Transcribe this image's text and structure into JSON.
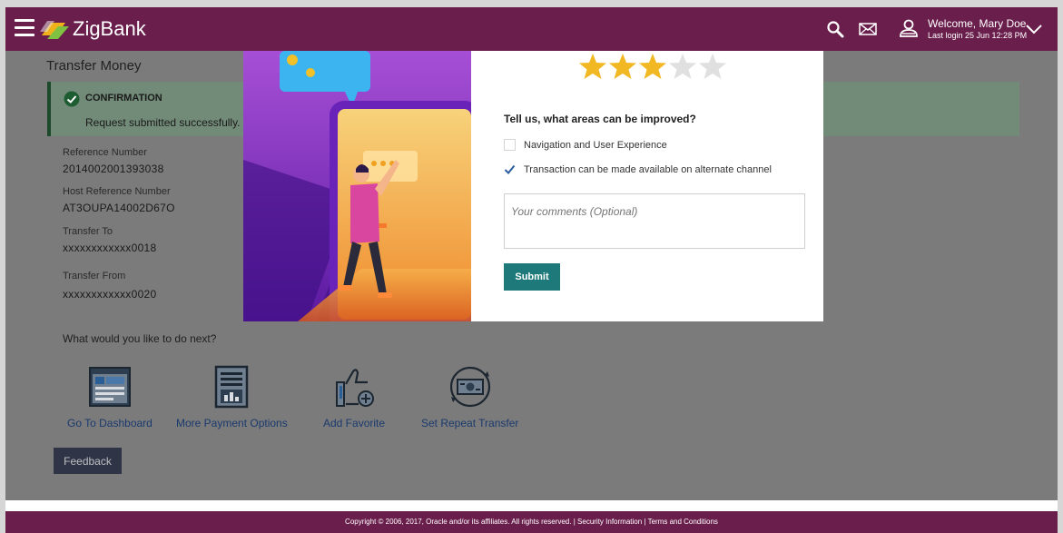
{
  "app": {
    "brand": "ZigBank"
  },
  "header": {
    "welcome": "Welcome, Mary Doe",
    "last_login": "Last login 25 Jun 12:28 PM"
  },
  "page": {
    "title": "Transfer Money",
    "confirmation": {
      "title": "CONFIRMATION",
      "message": "Request submitted successfully."
    },
    "fields": [
      {
        "label": "Reference Number",
        "value": "2014002001393038"
      },
      {
        "label": "Host Reference Number",
        "value": "AT3OUPA14002D67O"
      },
      {
        "label": "Transfer To",
        "value": "xxxxxxxxxxxx0018"
      },
      {
        "label": "Transfer From",
        "value": "xxxxxxxxxxxx0020"
      }
    ],
    "next_question": "What would you like to do next?",
    "actions": [
      {
        "label": "Go To Dashboard",
        "icon": "dashboard-icon"
      },
      {
        "label": "More Payment Options",
        "icon": "payment-options-icon"
      },
      {
        "label": "Add Favorite",
        "icon": "add-favorite-icon"
      },
      {
        "label": "Set Repeat Transfer",
        "icon": "repeat-transfer-icon"
      }
    ],
    "feedback_label": "Feedback"
  },
  "feedback_modal": {
    "rating": 3,
    "rating_max": 5,
    "question": "Tell us, what areas can be improved?",
    "options": [
      {
        "label": "Navigation and User Experience",
        "checked": false
      },
      {
        "label": "Transaction can be made available on alternate channel",
        "checked": true
      }
    ],
    "comments_placeholder": "Your comments (Optional)",
    "submit_label": "Submit"
  },
  "footer": {
    "copyright": "Copyright © 2006, 2017, Oracle and/or its affiliates. All rights reserved.",
    "security": "Security Information",
    "terms": "Terms and Conditions"
  },
  "colors": {
    "header": "#6a1e4c",
    "star_filled": "#f2b824",
    "star_empty": "#e0e0e0",
    "submit": "#1e7a7a"
  }
}
